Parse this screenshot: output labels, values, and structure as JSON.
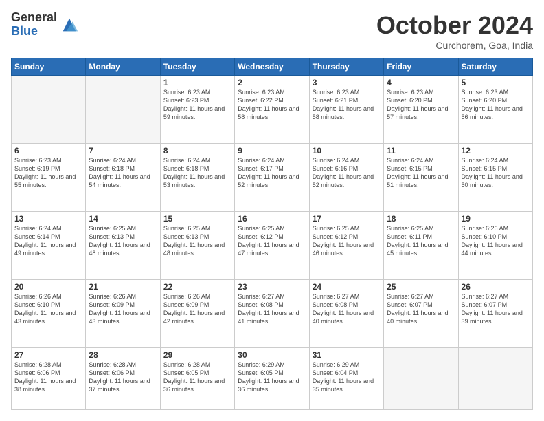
{
  "logo": {
    "general": "General",
    "blue": "Blue"
  },
  "title": "October 2024",
  "subtitle": "Curchorem, Goa, India",
  "days_header": [
    "Sunday",
    "Monday",
    "Tuesday",
    "Wednesday",
    "Thursday",
    "Friday",
    "Saturday"
  ],
  "weeks": [
    [
      {
        "day": "",
        "info": ""
      },
      {
        "day": "",
        "info": ""
      },
      {
        "day": "1",
        "info": "Sunrise: 6:23 AM\nSunset: 6:23 PM\nDaylight: 11 hours and 59 minutes."
      },
      {
        "day": "2",
        "info": "Sunrise: 6:23 AM\nSunset: 6:22 PM\nDaylight: 11 hours and 58 minutes."
      },
      {
        "day": "3",
        "info": "Sunrise: 6:23 AM\nSunset: 6:21 PM\nDaylight: 11 hours and 58 minutes."
      },
      {
        "day": "4",
        "info": "Sunrise: 6:23 AM\nSunset: 6:20 PM\nDaylight: 11 hours and 57 minutes."
      },
      {
        "day": "5",
        "info": "Sunrise: 6:23 AM\nSunset: 6:20 PM\nDaylight: 11 hours and 56 minutes."
      }
    ],
    [
      {
        "day": "6",
        "info": "Sunrise: 6:23 AM\nSunset: 6:19 PM\nDaylight: 11 hours and 55 minutes."
      },
      {
        "day": "7",
        "info": "Sunrise: 6:24 AM\nSunset: 6:18 PM\nDaylight: 11 hours and 54 minutes."
      },
      {
        "day": "8",
        "info": "Sunrise: 6:24 AM\nSunset: 6:18 PM\nDaylight: 11 hours and 53 minutes."
      },
      {
        "day": "9",
        "info": "Sunrise: 6:24 AM\nSunset: 6:17 PM\nDaylight: 11 hours and 52 minutes."
      },
      {
        "day": "10",
        "info": "Sunrise: 6:24 AM\nSunset: 6:16 PM\nDaylight: 11 hours and 52 minutes."
      },
      {
        "day": "11",
        "info": "Sunrise: 6:24 AM\nSunset: 6:15 PM\nDaylight: 11 hours and 51 minutes."
      },
      {
        "day": "12",
        "info": "Sunrise: 6:24 AM\nSunset: 6:15 PM\nDaylight: 11 hours and 50 minutes."
      }
    ],
    [
      {
        "day": "13",
        "info": "Sunrise: 6:24 AM\nSunset: 6:14 PM\nDaylight: 11 hours and 49 minutes."
      },
      {
        "day": "14",
        "info": "Sunrise: 6:25 AM\nSunset: 6:13 PM\nDaylight: 11 hours and 48 minutes."
      },
      {
        "day": "15",
        "info": "Sunrise: 6:25 AM\nSunset: 6:13 PM\nDaylight: 11 hours and 48 minutes."
      },
      {
        "day": "16",
        "info": "Sunrise: 6:25 AM\nSunset: 6:12 PM\nDaylight: 11 hours and 47 minutes."
      },
      {
        "day": "17",
        "info": "Sunrise: 6:25 AM\nSunset: 6:12 PM\nDaylight: 11 hours and 46 minutes."
      },
      {
        "day": "18",
        "info": "Sunrise: 6:25 AM\nSunset: 6:11 PM\nDaylight: 11 hours and 45 minutes."
      },
      {
        "day": "19",
        "info": "Sunrise: 6:26 AM\nSunset: 6:10 PM\nDaylight: 11 hours and 44 minutes."
      }
    ],
    [
      {
        "day": "20",
        "info": "Sunrise: 6:26 AM\nSunset: 6:10 PM\nDaylight: 11 hours and 43 minutes."
      },
      {
        "day": "21",
        "info": "Sunrise: 6:26 AM\nSunset: 6:09 PM\nDaylight: 11 hours and 43 minutes."
      },
      {
        "day": "22",
        "info": "Sunrise: 6:26 AM\nSunset: 6:09 PM\nDaylight: 11 hours and 42 minutes."
      },
      {
        "day": "23",
        "info": "Sunrise: 6:27 AM\nSunset: 6:08 PM\nDaylight: 11 hours and 41 minutes."
      },
      {
        "day": "24",
        "info": "Sunrise: 6:27 AM\nSunset: 6:08 PM\nDaylight: 11 hours and 40 minutes."
      },
      {
        "day": "25",
        "info": "Sunrise: 6:27 AM\nSunset: 6:07 PM\nDaylight: 11 hours and 40 minutes."
      },
      {
        "day": "26",
        "info": "Sunrise: 6:27 AM\nSunset: 6:07 PM\nDaylight: 11 hours and 39 minutes."
      }
    ],
    [
      {
        "day": "27",
        "info": "Sunrise: 6:28 AM\nSunset: 6:06 PM\nDaylight: 11 hours and 38 minutes."
      },
      {
        "day": "28",
        "info": "Sunrise: 6:28 AM\nSunset: 6:06 PM\nDaylight: 11 hours and 37 minutes."
      },
      {
        "day": "29",
        "info": "Sunrise: 6:28 AM\nSunset: 6:05 PM\nDaylight: 11 hours and 36 minutes."
      },
      {
        "day": "30",
        "info": "Sunrise: 6:29 AM\nSunset: 6:05 PM\nDaylight: 11 hours and 36 minutes."
      },
      {
        "day": "31",
        "info": "Sunrise: 6:29 AM\nSunset: 6:04 PM\nDaylight: 11 hours and 35 minutes."
      },
      {
        "day": "",
        "info": ""
      },
      {
        "day": "",
        "info": ""
      }
    ]
  ]
}
